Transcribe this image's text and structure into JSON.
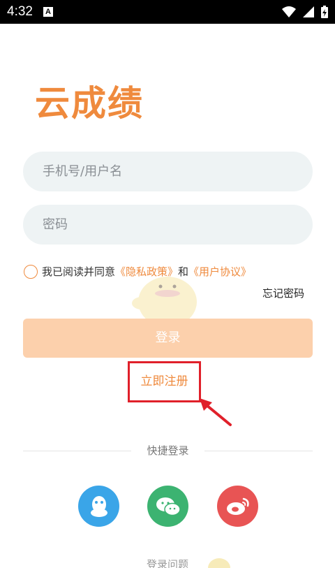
{
  "status_bar": {
    "time": "4:32",
    "notification_letter": "A"
  },
  "app": {
    "logo": "云成绩"
  },
  "form": {
    "username_placeholder": "手机号/用户名",
    "password_placeholder": "密码",
    "agree_prefix": "我已阅读并同意",
    "privacy_link": "《隐私政策》",
    "and_text": "和",
    "terms_link": "《用户协议》",
    "forgot_password": "忘记密码",
    "login_button": "登录",
    "register_link": "立即注册"
  },
  "quick_login": {
    "title": "快捷登录",
    "providers": [
      "qq-icon",
      "wechat-icon",
      "weibo-icon"
    ]
  },
  "footer": {
    "problem_text": "登录问题"
  },
  "colors": {
    "accent": "#ef8a3d",
    "login_button": "#fcd0ac",
    "highlight": "#e0202a",
    "qq": "#3aa5e8",
    "wechat": "#3cb371",
    "weibo": "#e85454"
  }
}
